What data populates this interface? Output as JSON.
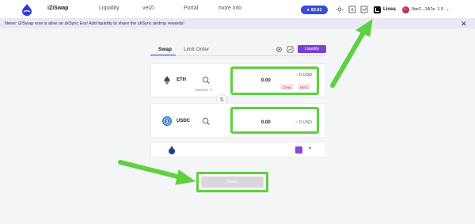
{
  "nav": {
    "brand": "iZiSwap",
    "items": [
      "Liquidity",
      "veiZi",
      "Portal",
      "more info"
    ]
  },
  "header": {
    "balance": "$3.01",
    "network": "Linea",
    "account": "0xe2...1A7e",
    "account_extra": "1 0"
  },
  "banner": {
    "text": "News: iZiSwap now is alive on zkSync Era! Add liquidity to share the zkSync airdrop rewards!",
    "close": "✕"
  },
  "swap": {
    "tabs": [
      "Swap",
      "Limit Order"
    ],
    "liquidity_button": "Liquidity",
    "from": {
      "token": "ETH",
      "amount": "0.00",
      "usd": "~ 0 USD",
      "chips": [
        "Clear",
        "MAX"
      ],
      "balance": "Balance: 0"
    },
    "to": {
      "token": "USDC",
      "amount": "0.00",
      "usd": "~ 0 USD"
    },
    "flip_symbol": "⇅",
    "caret": "▾",
    "action_button": "Swap"
  },
  "colors": {
    "accent": "#3a4bd8",
    "highlight": "#5ed13f",
    "liquidity": "#7b3fd6"
  }
}
